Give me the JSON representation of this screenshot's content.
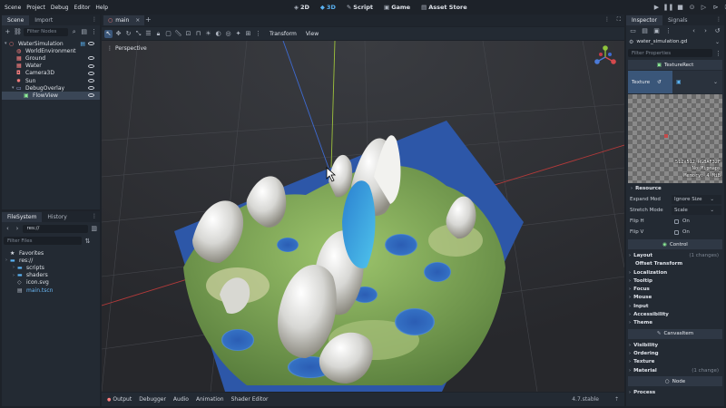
{
  "menubar": {
    "items": [
      "Scene",
      "Project",
      "Debug",
      "Editor",
      "Help"
    ],
    "workspaces": [
      {
        "label": "2D",
        "icon": "2d-icon",
        "active": false
      },
      {
        "label": "3D",
        "icon": "3d-icon",
        "active": true
      },
      {
        "label": "Script",
        "icon": "script-icon",
        "active": false
      },
      {
        "label": "Game",
        "icon": "game-icon",
        "active": false
      },
      {
        "label": "Asset Store",
        "icon": "asset-store-icon",
        "active": false
      }
    ],
    "run_controls": [
      "play-icon",
      "pause-icon",
      "stop-icon",
      "remote-debug-icon",
      "play-scene-icon",
      "play-custom-icon",
      "movie-icon"
    ]
  },
  "scene_dock": {
    "tabs": [
      "Scene",
      "Import"
    ],
    "filter_placeholder": "Filter Nodes",
    "nodes": [
      {
        "label": "WaterSimulation",
        "icon": "node3d-icon",
        "color": "#fc7f7f",
        "depth": 0,
        "selected": false,
        "visible": true
      },
      {
        "label": "WorldEnvironment",
        "icon": "world-env-icon",
        "color": "#fc7f7f",
        "depth": 1,
        "selected": false,
        "visible": false
      },
      {
        "label": "Ground",
        "icon": "mesh-icon",
        "color": "#fc7f7f",
        "depth": 1,
        "selected": false,
        "visible": true
      },
      {
        "label": "Water",
        "icon": "mesh-icon",
        "color": "#fc7f7f",
        "depth": 1,
        "selected": false,
        "visible": true
      },
      {
        "label": "Camera3D",
        "icon": "camera-icon",
        "color": "#fc7f7f",
        "depth": 1,
        "selected": false,
        "visible": true
      },
      {
        "label": "Sun",
        "icon": "light-icon",
        "color": "#fc7f7f",
        "depth": 1,
        "selected": false,
        "visible": true
      },
      {
        "label": "DebugOverlay",
        "icon": "canvas-layer-icon",
        "color": "#a5b7f3",
        "depth": 1,
        "selected": false,
        "visible": true
      },
      {
        "label": "FlowView",
        "icon": "texture-rect-icon",
        "color": "#8eef97",
        "depth": 2,
        "selected": true,
        "visible": true
      }
    ]
  },
  "filesystem_dock": {
    "tabs": [
      "FileSystem",
      "History"
    ],
    "path": "res://",
    "filter_placeholder": "Filter Files",
    "items": [
      {
        "label": "Favorites",
        "icon": "star-icon",
        "depth": 0,
        "color": "#dce0e6"
      },
      {
        "label": "res://",
        "icon": "folder-icon",
        "depth": 0,
        "color": "#dce0e6"
      },
      {
        "label": "scripts",
        "icon": "folder-icon",
        "depth": 1,
        "color": "#dce0e6"
      },
      {
        "label": "shaders",
        "icon": "folder-icon",
        "depth": 1,
        "color": "#dce0e6"
      },
      {
        "label": "icon.svg",
        "icon": "svg-file-icon",
        "depth": 1,
        "color": "#dce0e6"
      },
      {
        "label": "main.tscn",
        "icon": "scene-file-icon",
        "depth": 1,
        "color": "#6ab7f4"
      }
    ]
  },
  "editor_tabs": {
    "tabs": [
      {
        "label": "main",
        "active": true
      }
    ],
    "add_tab": "+"
  },
  "viewport_toolbar": {
    "menus": [
      "Transform",
      "View"
    ]
  },
  "viewport": {
    "label": "Perspective"
  },
  "bottom_panel": {
    "tabs": [
      "Output",
      "Debugger",
      "Audio",
      "Animation",
      "Shader Editor"
    ],
    "version": "4.7.stable"
  },
  "inspector": {
    "tabs": [
      "Inspector",
      "Signals"
    ],
    "resource_file": "water_simulation.gd",
    "filter_placeholder": "Filter Properties",
    "class_header": "TextureRect",
    "texture_label": "Texture",
    "texture_info": [
      "512x512 RGBAF32F",
      "No Mipmaps",
      "Memory: 4 MiB"
    ],
    "resource_section": "Resource",
    "properties": [
      {
        "label": "Expand Mod",
        "value": "Ignore Size",
        "kind": "dropdown"
      },
      {
        "label": "Stretch Mode",
        "value": "Scale",
        "kind": "dropdown"
      },
      {
        "label": "Flip H",
        "value": "On",
        "kind": "check"
      },
      {
        "label": "Flip V",
        "value": "On",
        "kind": "check"
      }
    ],
    "control_header": "Control",
    "control_sections": [
      {
        "label": "Layout",
        "note": "(1 changes)"
      },
      {
        "label": "Offset Transform",
        "note": "",
        "indent": true
      },
      {
        "label": "Localization",
        "note": ""
      },
      {
        "label": "Tooltip",
        "note": ""
      },
      {
        "label": "Focus",
        "note": ""
      },
      {
        "label": "Mouse",
        "note": ""
      },
      {
        "label": "Input",
        "note": ""
      },
      {
        "label": "Accessibility",
        "note": ""
      },
      {
        "label": "Theme",
        "note": ""
      }
    ],
    "canvas_header": "CanvasItem",
    "canvas_sections": [
      {
        "label": "Visibility",
        "note": ""
      },
      {
        "label": "Ordering",
        "note": ""
      },
      {
        "label": "Texture",
        "note": ""
      },
      {
        "label": "Material",
        "note": "(1 change)"
      }
    ],
    "node_header": "Node",
    "node_sections": [
      {
        "label": "Process",
        "note": ""
      }
    ]
  },
  "colors": {
    "accent": "#5ab2f2",
    "node3d": "#fc7f7f",
    "control": "#8eef97",
    "water": "#2d57a8",
    "terrain_green": "#7fb35a"
  }
}
